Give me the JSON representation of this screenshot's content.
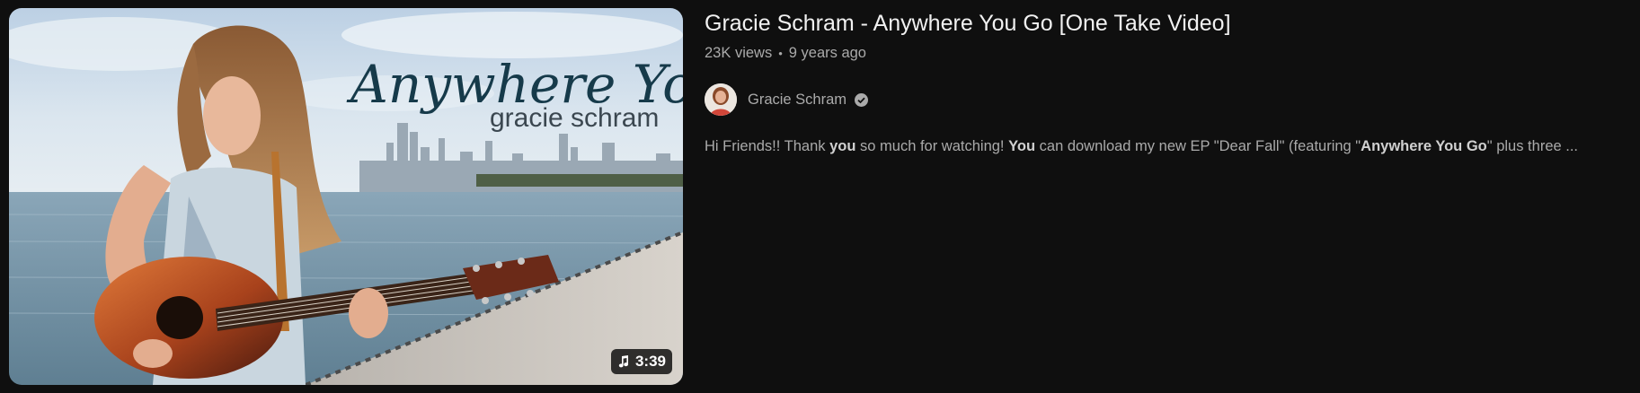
{
  "video": {
    "title": "Gracie Schram - Anywhere You Go [One Take Video]",
    "views": "23K views",
    "separator": "•",
    "age": "9 years ago",
    "duration": "3:39",
    "thumbnail_text": {
      "title": "Anywhere You Go",
      "artist": "gracie schram"
    }
  },
  "channel": {
    "name": "Gracie Schram",
    "verified_icon": "verified-check-icon"
  },
  "description": {
    "parts": [
      {
        "text": "Hi Friends!! Thank ",
        "bold": false
      },
      {
        "text": "you",
        "bold": true
      },
      {
        "text": " so much for watching! ",
        "bold": false
      },
      {
        "text": "You",
        "bold": true
      },
      {
        "text": " can download my new EP \"Dear Fall\" (featuring \"",
        "bold": false
      },
      {
        "text": "Anywhere You Go",
        "bold": true
      },
      {
        "text": "\" plus three ...",
        "bold": false
      }
    ]
  },
  "colors": {
    "background": "#0f0f0f",
    "title": "#f1f1f1",
    "secondary": "#aaaaaa"
  }
}
